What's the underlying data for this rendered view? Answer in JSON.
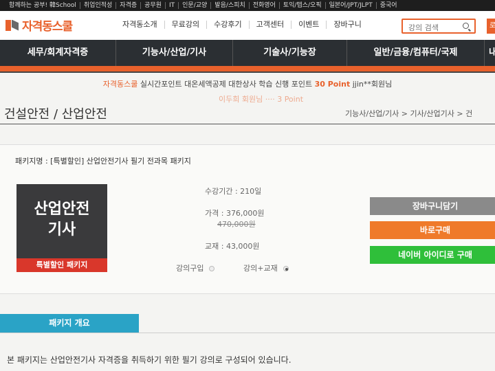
{
  "topbar": {
    "items": [
      "함께하는 공부! 韓School",
      "취업인적성",
      "자격증",
      "공무원",
      "IT",
      "인문/교양",
      "발음/스피치",
      "전화영어",
      "토익/텝스/오픽",
      "일본어/JPT/JLPT",
      "중국어"
    ]
  },
  "header": {
    "logo_text": "자격동스쿨",
    "nav": [
      "자격동소개",
      "무료강의",
      "수강후기",
      "고객센터",
      "이벤트",
      "장바구니"
    ],
    "search_placeholder": "강의 검색",
    "login_label": "로"
  },
  "categories": [
    "세무/회계자격증",
    "기능사/산업/기사",
    "기술사/기능장",
    "일반/금융/컴퓨터/국제",
    "내"
  ],
  "ticker": {
    "brand": "자격동스쿨",
    "text": " 실시간포인트 대온세액공제 대한상사 학습 신행 포인트 ",
    "points": "30 Point",
    "user": " jjin**회원님",
    "line2": "이두희 회원님 ···· 3 Point"
  },
  "page": {
    "title": "건설안전 / 산업안전",
    "breadcrumb": "기능사/산업/기사 > 기사/산업기사 > 건"
  },
  "package": {
    "name_label": "패키지명 : [특별할인] 산업안전기사 필기 전과목 패키지",
    "thumb_title": "산업안전\n기사",
    "thumb_line1": "산업안전",
    "thumb_line2": "기사",
    "thumb_ribbon": "특별할인 패키지",
    "period": "수강기간 : 210일",
    "price": "가격 : 376,000원",
    "original_price": "470,000원",
    "textbook": "교재 : 43,000원",
    "option_lecture": "강의구입",
    "option_lecture_book": "강의+교재"
  },
  "actions": {
    "cart": "장바구니담기",
    "buy": "바로구매",
    "naver": "네이버 아이디로 구매"
  },
  "colors": {
    "accent": "#e8612c",
    "nav_bg": "#2b2f33",
    "cart_btn": "#8a8a8a",
    "buy_btn": "#ef7a2a",
    "naver_btn": "#2fbf3a",
    "tab": "#2aa3c6"
  },
  "overview": {
    "tab_label": "패키지 개요",
    "description": "본 패키지는 산업안전기사 자격증을 취득하기 위한 필기 강의로 구성되어 있습니다."
  }
}
